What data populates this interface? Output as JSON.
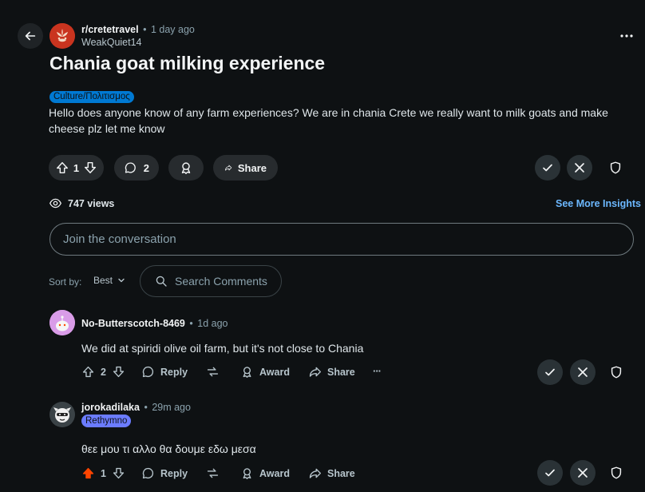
{
  "post": {
    "subreddit": "r/cretetravel",
    "separator": "•",
    "time": "1 day ago",
    "author": "WeakQuiet14",
    "title": "Chania goat milking experience",
    "flair": "Culture/Πολιτισμος",
    "body": "Hello does anyone know of any farm experiences? We are in chania Crete we really want to milk goats and make cheese plz let me know",
    "votes": "1",
    "comments": "2",
    "share_label": "Share",
    "views": "747 views",
    "insights_label": "See More Insights"
  },
  "composer": {
    "placeholder": "Join the conversation"
  },
  "sort": {
    "label": "Sort by:",
    "value": "Best",
    "search_placeholder": "Search Comments"
  },
  "comments": [
    {
      "author": "No-Butterscotch-8469",
      "separator": "•",
      "time": "1d ago",
      "text": "We did at spiridi olive oil farm, but it's not close to Chania",
      "votes": "2",
      "reply": "Reply",
      "award": "Award",
      "share": "Share",
      "more": "···"
    },
    {
      "author": "jorokadilaka",
      "separator": "•",
      "time": "29m ago",
      "flair": "Rethymno",
      "text": "θεε μου τι αλλο θα δουμε εδω μεσα",
      "votes": "1",
      "reply": "Reply",
      "award": "Award",
      "share": "Share"
    }
  ],
  "colors": {
    "background": "#0e1113",
    "flair": "#0079d3",
    "link": "#6cb8ff",
    "upvoted": "#ff4500",
    "user_flair": "#6b7cff"
  },
  "icons": [
    "back-arrow-icon",
    "subreddit-icon",
    "more-icon",
    "upvote-icon",
    "downvote-icon",
    "comment-icon",
    "award-icon",
    "share-icon",
    "approve-icon",
    "remove-icon",
    "shield-icon",
    "views-icon",
    "search-icon",
    "chevron-down-icon",
    "avatar",
    "reply-icon",
    "crosspost-icon"
  ]
}
